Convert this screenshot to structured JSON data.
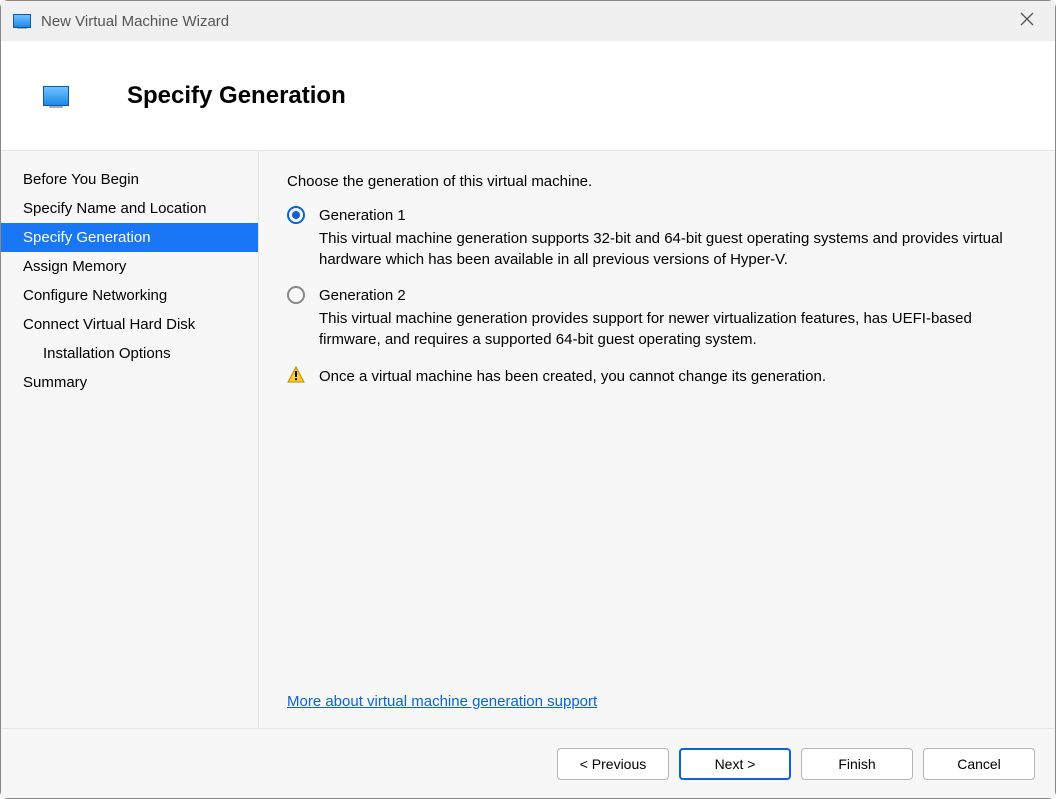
{
  "window": {
    "title": "New Virtual Machine Wizard"
  },
  "header": {
    "title": "Specify Generation"
  },
  "sidebar": {
    "steps": [
      {
        "label": "Before You Begin",
        "active": false,
        "indent": false
      },
      {
        "label": "Specify Name and Location",
        "active": false,
        "indent": false
      },
      {
        "label": "Specify Generation",
        "active": true,
        "indent": false
      },
      {
        "label": "Assign Memory",
        "active": false,
        "indent": false
      },
      {
        "label": "Configure Networking",
        "active": false,
        "indent": false
      },
      {
        "label": "Connect Virtual Hard Disk",
        "active": false,
        "indent": false
      },
      {
        "label": "Installation Options",
        "active": false,
        "indent": true
      },
      {
        "label": "Summary",
        "active": false,
        "indent": false
      }
    ]
  },
  "content": {
    "intro": "Choose the generation of this virtual machine.",
    "options": [
      {
        "label": "Generation 1",
        "selected": true,
        "desc": "This virtual machine generation supports 32-bit and 64-bit guest operating systems and provides virtual hardware which has been available in all previous versions of Hyper-V."
      },
      {
        "label": "Generation 2",
        "selected": false,
        "desc": "This virtual machine generation provides support for newer virtualization features, has UEFI-based firmware, and requires a supported 64-bit guest operating system."
      }
    ],
    "warning": "Once a virtual machine has been created, you cannot change its generation.",
    "more_link": "More about virtual machine generation support"
  },
  "footer": {
    "previous": "< Previous",
    "next": "Next >",
    "finish": "Finish",
    "cancel": "Cancel"
  }
}
